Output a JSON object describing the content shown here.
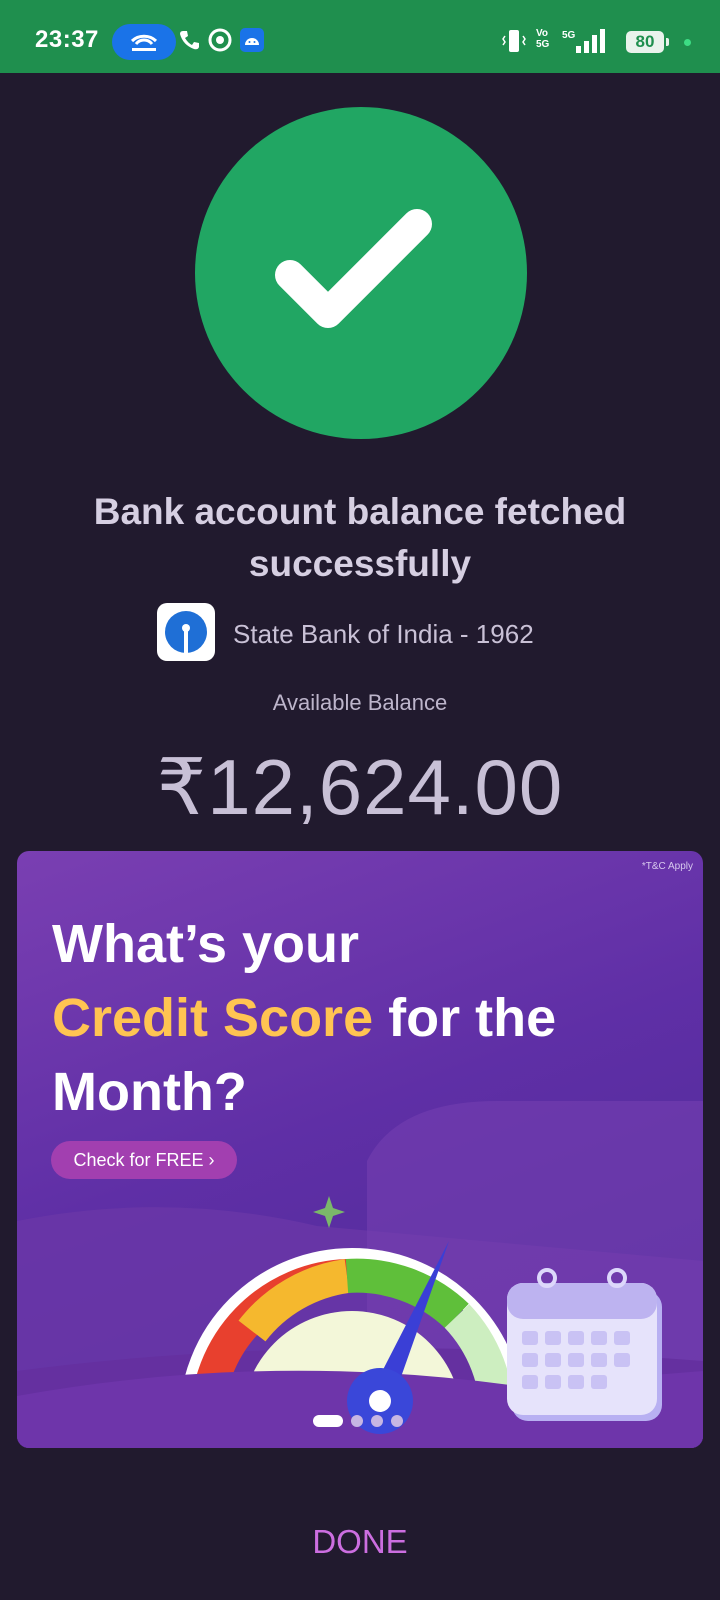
{
  "status_bar": {
    "time": "23:37",
    "battery": "80",
    "icons": [
      "hotspot-icon",
      "phone-icon",
      "whatsapp-icon",
      "android-icon",
      "vibrate-icon",
      "volte-icon",
      "signal-5g-icon",
      "battery-icon"
    ]
  },
  "success": {
    "icon": "check-icon",
    "headline": "Bank account balance fetched successfully",
    "accent": "#21a663"
  },
  "bank": {
    "name": "State Bank of India - 1962",
    "logo_icon": "sbi-logo-icon"
  },
  "balance": {
    "label": "Available Balance",
    "amount": "₹12,624.00"
  },
  "banner": {
    "tnc": "*T&C Apply",
    "title_line1": "What’s your",
    "title_highlight": "Credit Score",
    "title_rest": " for the",
    "title_line3": "Month?",
    "cta": "Check for FREE ›",
    "carousel_active": 1,
    "carousel_total": 4
  },
  "footer": {
    "done_label": "DONE"
  },
  "colors": {
    "status_bar": "#1f8f4e",
    "background": "#211a2e",
    "done": "#cc6ee0"
  }
}
